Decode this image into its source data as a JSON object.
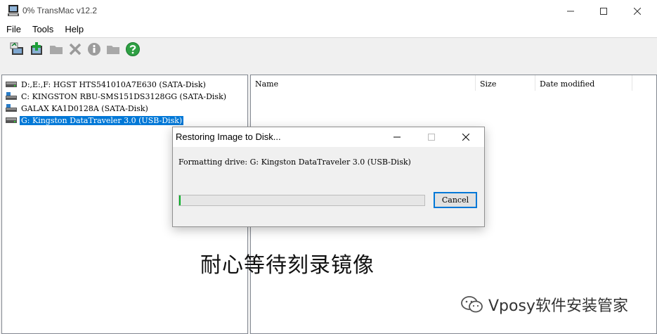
{
  "window": {
    "title": "0% TransMac v12.2"
  },
  "menu": [
    "File",
    "Tools",
    "Help"
  ],
  "toolbar": {
    "icons": [
      "restore-image-icon",
      "add-disk-icon",
      "folder-icon",
      "delete-icon",
      "info-icon",
      "folder-open-icon",
      "help-icon"
    ]
  },
  "drives": [
    {
      "label": "D:,E:,F:  HGST HTS541010A7E630 (SATA-Disk)",
      "selected": false
    },
    {
      "label": "C:  KINGSTON RBU-SMS151DS3128GG (SATA-Disk)",
      "selected": false
    },
    {
      "label": " GALAX KA1D0128A (SATA-Disk)",
      "selected": false
    },
    {
      "label": "G: Kingston DataTraveler 3.0 (USB-Disk)",
      "selected": true
    }
  ],
  "file_list": {
    "columns": [
      "Name",
      "Size",
      "Date modified"
    ]
  },
  "dialog": {
    "title": "Restoring Image to Disk...",
    "message": "Formatting drive: G: Kingston DataTraveler 3.0 (USB-Disk)",
    "progress": 0.005,
    "cancel_label": "Cancel"
  },
  "overlay": {
    "caption": "耐心等待刻录镜像",
    "watermark": "Vposy软件安装管家"
  },
  "colors": {
    "selection": "#0078d7",
    "progress": "#06b025"
  }
}
